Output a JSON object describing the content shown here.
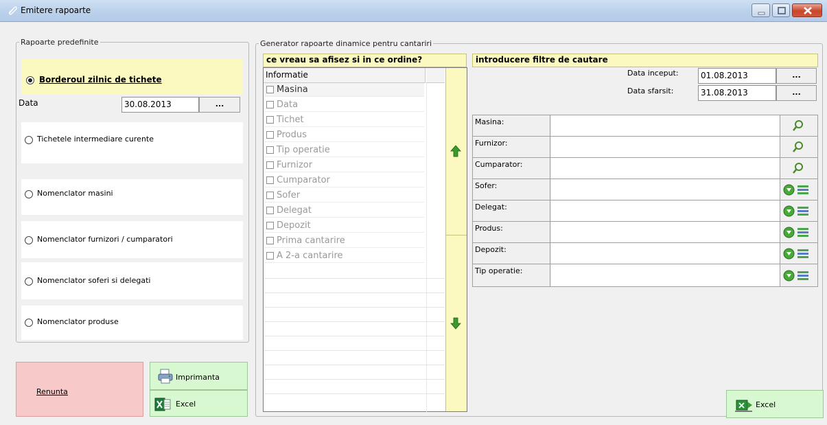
{
  "window": {
    "title": "Emitere rapoarte"
  },
  "left": {
    "legend": "Rapoarte predefinite",
    "options": [
      {
        "label": "Borderoul zilnic de tichete",
        "selected": true
      },
      {
        "label": "Tichetele intermediare curente",
        "selected": false
      },
      {
        "label": "Nomenclator masini",
        "selected": false
      },
      {
        "label": "Nomenclator furnizori / cumparatori",
        "selected": false
      },
      {
        "label": "Nomenclator soferi si delegati",
        "selected": false
      },
      {
        "label": "Nomenclator produse",
        "selected": false
      }
    ],
    "date_label": "Data",
    "date_value": "30.08.2013",
    "picker_label": "...",
    "cancel_label": "Renunta",
    "print_label": "Imprimanta",
    "excel_label": "Excel"
  },
  "generator": {
    "legend": "Generator rapoarte dinamice pentru cantariri",
    "order_header": "ce vreau sa afisez si in ce ordine?",
    "list_header": "Informatie",
    "items": [
      "Masina",
      "Data",
      "Tichet",
      "Produs",
      "Tip operatie",
      "Furnizor",
      "Cumparator",
      "Sofer",
      "Delegat",
      "Depozit",
      "Prima cantarire",
      "A 2-a cantarire"
    ],
    "filters_header": "introducere filtre de cautare",
    "start_label": "Data inceput:",
    "start_value": "01.08.2013",
    "end_label": "Data sfarsit:",
    "end_value": "31.08.2013",
    "picker_label": "...",
    "filters": [
      {
        "label": "Masina:",
        "icon": "search-icon"
      },
      {
        "label": "Furnizor:",
        "icon": "search-icon"
      },
      {
        "label": "Cumparator:",
        "icon": "search-icon"
      },
      {
        "label": "Sofer:",
        "icon": "dropdown-list-icon"
      },
      {
        "label": "Delegat:",
        "icon": "dropdown-list-icon"
      },
      {
        "label": "Produs:",
        "icon": "dropdown-list-icon"
      },
      {
        "label": "Depozit:",
        "icon": "dropdown-list-icon"
      },
      {
        "label": "Tip operatie:",
        "icon": "dropdown-list-icon"
      }
    ],
    "excel_label": "Excel"
  },
  "colors": {
    "highlight_yellow": "#fbf8c0",
    "button_green": "#d7f8d0",
    "button_red": "#f8c9c9",
    "arrow_green": "#3a9a2b"
  }
}
